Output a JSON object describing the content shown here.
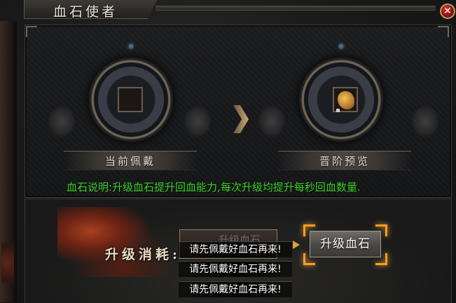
{
  "window": {
    "title": "血石使者",
    "close_glyph": "✕"
  },
  "current": {
    "label": "当前佩戴",
    "slot_icon": "empty-slot"
  },
  "next": {
    "label": "晋阶预览",
    "item_icon": "blood-stone-icon"
  },
  "description": "血石说明:升级血石提升回血能力,每次升级均提升每秒回血数量.",
  "upgrade": {
    "cost_label": "升级消耗:",
    "cost_value": "升级血石",
    "button_label": "升级血石"
  },
  "messages": [
    "请先佩戴好血石再来!",
    "请先佩戴好血石再来!",
    "请先佩戴好血石再来!"
  ],
  "colors": {
    "description": "#3fd12a",
    "highlight_bracket": "#ff9c1a",
    "close_button": "#c42a22"
  }
}
